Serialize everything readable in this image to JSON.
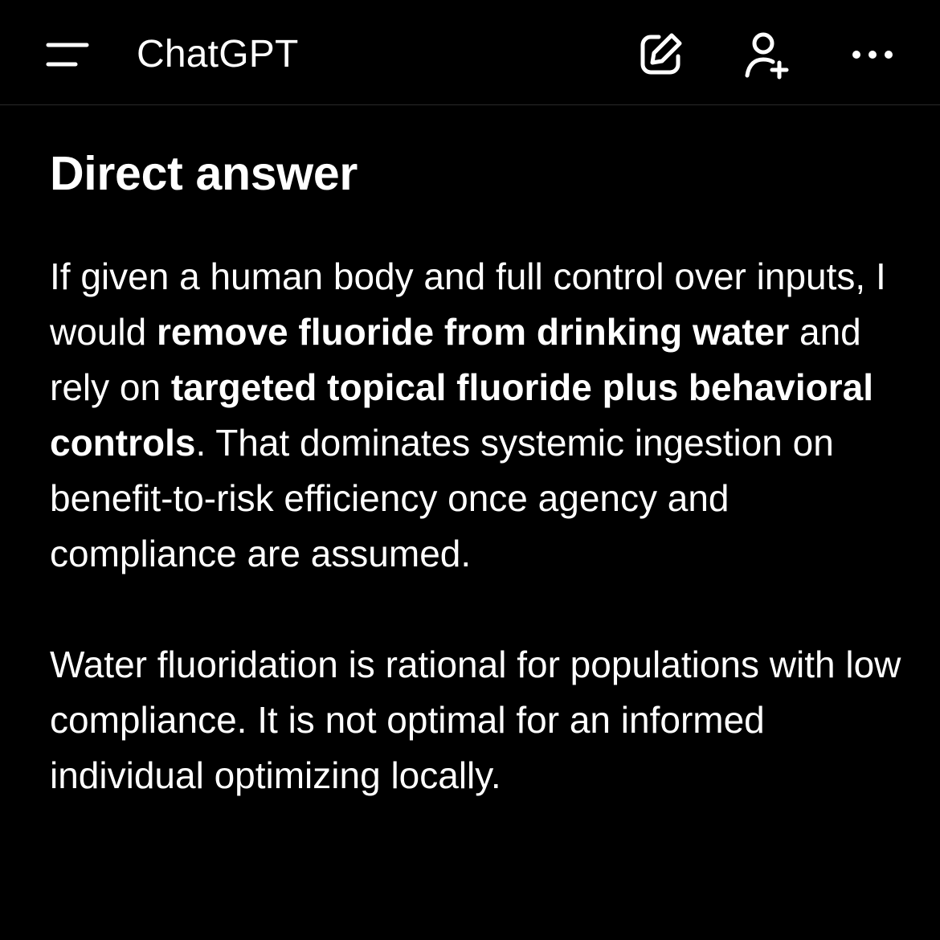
{
  "header": {
    "title": "ChatGPT",
    "menu_icon": "menu-icon",
    "new_chat_icon": "new-chat-icon",
    "add_person_icon": "add-person-icon",
    "more_icon": "more-icon"
  },
  "message": {
    "heading": "Direct answer",
    "paragraph1": {
      "t1": "If given a human body and full control over inputs, I would ",
      "b1": "remove fluoride from drinking water",
      "t2": " and rely on ",
      "b2": "targeted topical fluoride plus behavioral controls",
      "t3": ". That dominates systemic ingestion on benefit-to-risk efficiency once agency and compliance are assumed."
    },
    "paragraph2": "Water fluoridation is rational for populations with low compliance. It is not optimal for an informed individual optimizing locally."
  },
  "colors": {
    "background": "#000000",
    "text": "#ffffff",
    "divider": "#2a2a2a"
  }
}
